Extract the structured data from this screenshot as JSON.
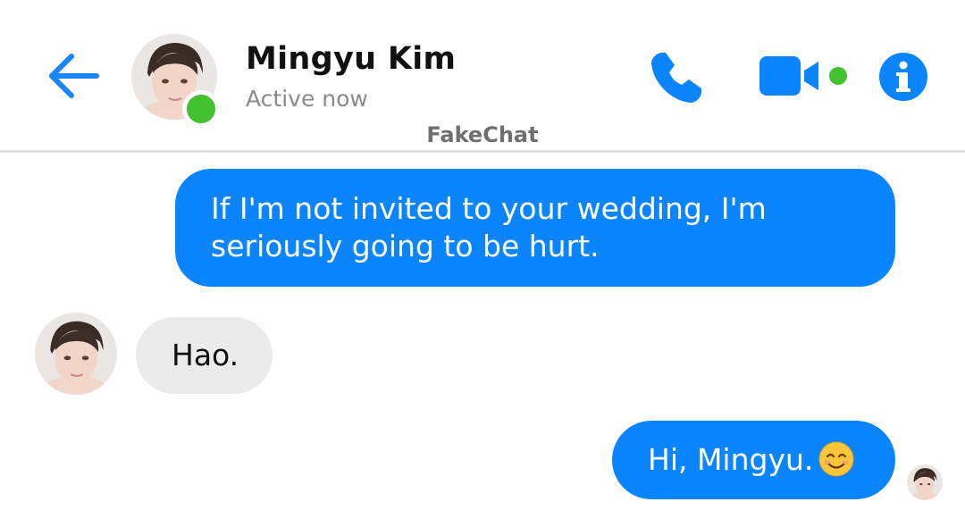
{
  "header": {
    "contact_name": "Mingyu Kim",
    "status": "Active now",
    "watermark": "FakeChat",
    "back_icon": "arrow-left-icon",
    "call_icon": "phone-icon",
    "video_icon": "video-camera-icon",
    "info_icon": "info-icon"
  },
  "messages": [
    {
      "direction": "outgoing",
      "text": "If I'm not invited to your wedding, I'm seriously going to be hurt."
    },
    {
      "direction": "incoming",
      "text": "Hao."
    },
    {
      "direction": "outgoing",
      "text": "Hi, Mingyu.",
      "emoji": "smiling-face-emoji"
    }
  ],
  "colors": {
    "accent": "#0a84ff",
    "incoming_bubble": "#ebebeb",
    "presence": "#43c230",
    "divider": "#e2e2e2"
  }
}
